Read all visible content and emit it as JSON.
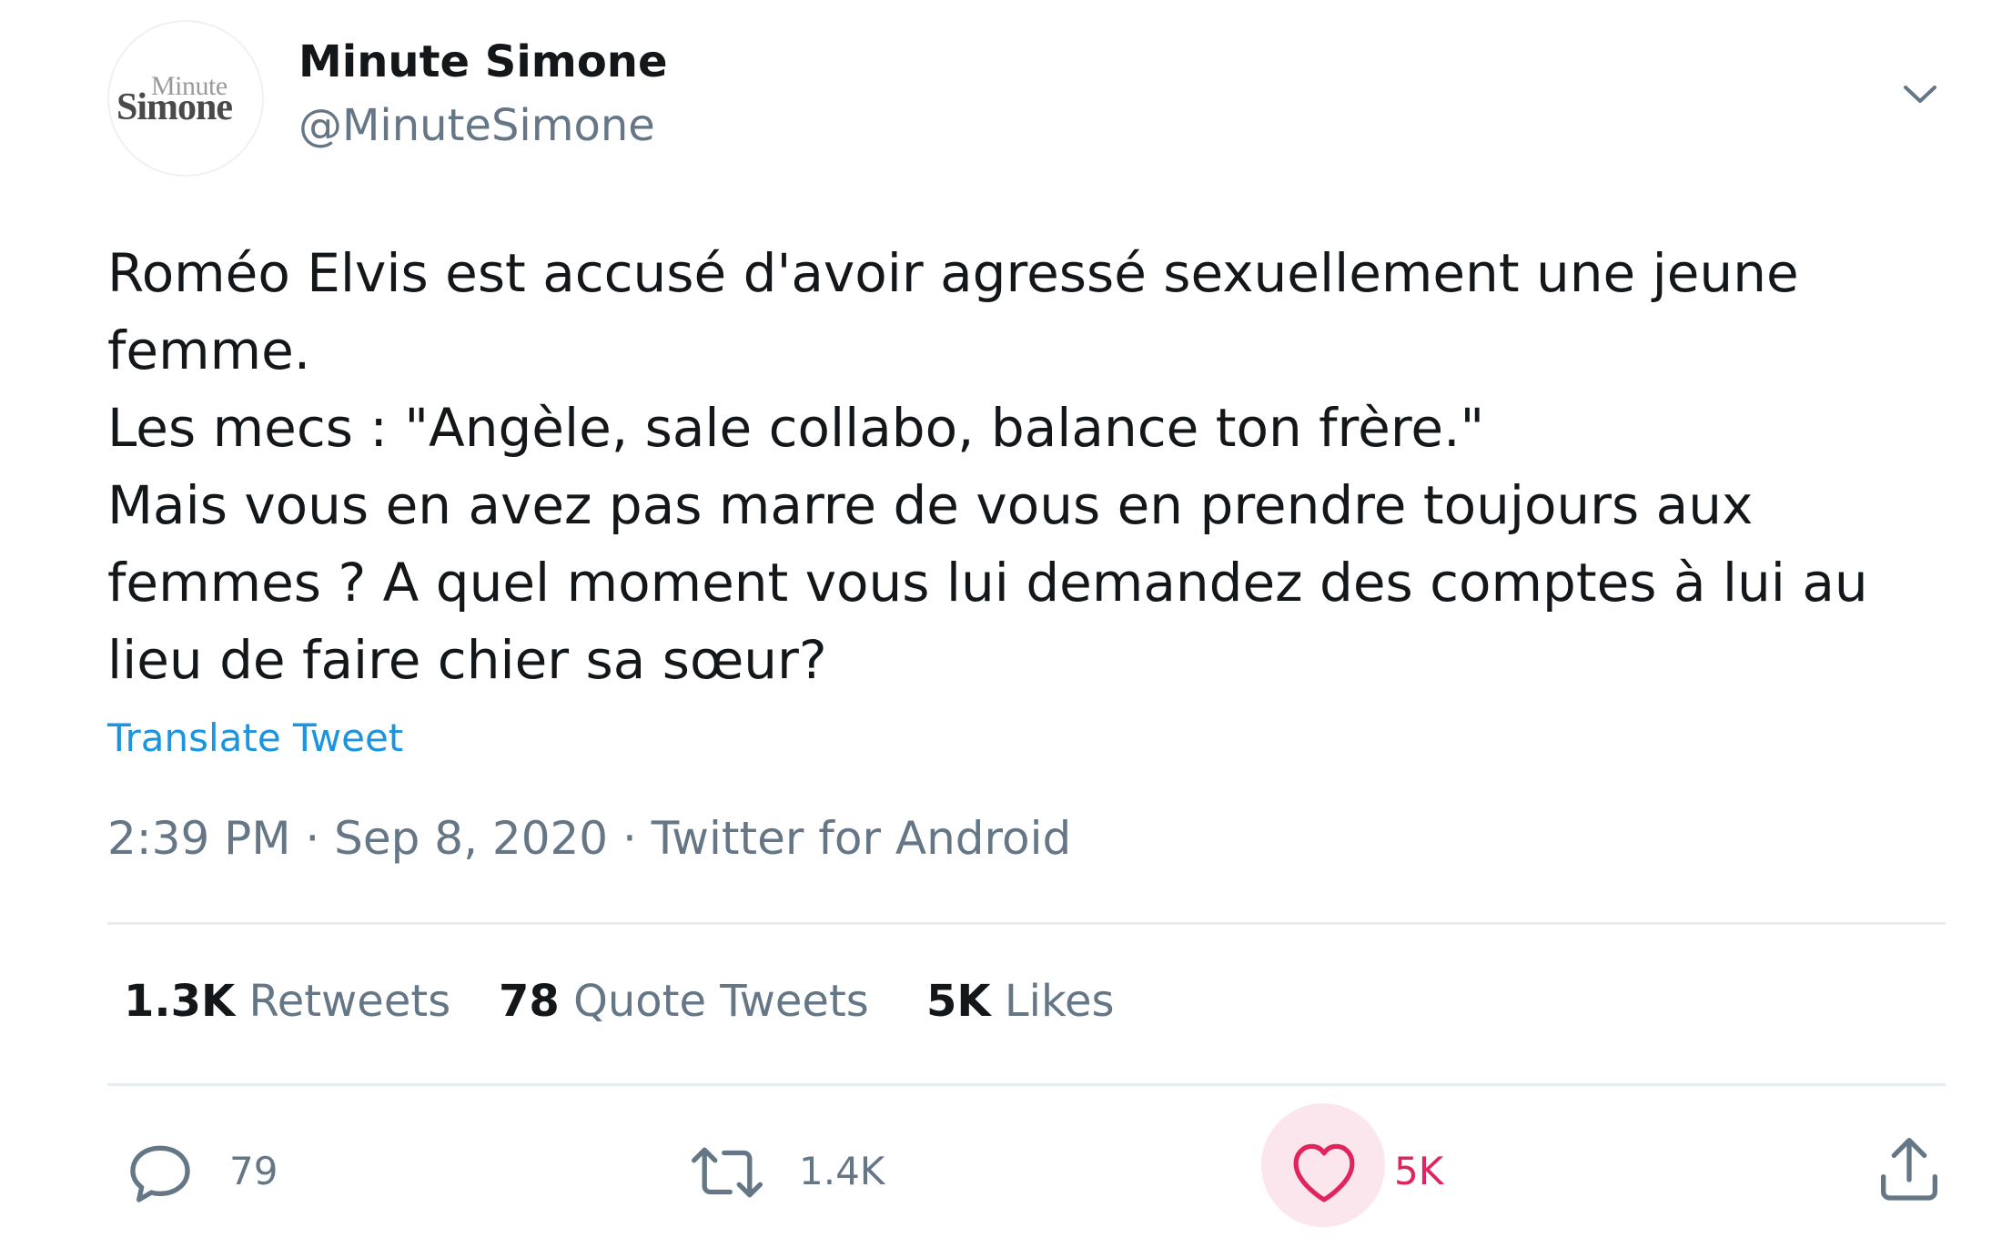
{
  "author": {
    "avatar_text_top": "Minute",
    "avatar_text_bottom": "Simone",
    "display_name": "Minute Simone",
    "handle": "@MinuteSimone"
  },
  "tweet": {
    "lines": [
      "Roméo Elvis est accusé d'avoir agressé sexuellement une jeune",
      "femme.",
      "Les mecs : \"Angèle, sale collabo, balance ton frère.\"",
      "Mais vous en avez pas marre de vous en prendre toujours aux",
      "femmes ? A quel moment vous lui demandez des comptes à lui au",
      "lieu de faire chier sa sœur?"
    ],
    "translate_label": "Translate Tweet",
    "meta": "2:39 PM · Sep 8, 2020 · Twitter for Android"
  },
  "stats": {
    "retweets_count": "1.3K",
    "retweets_label": "Retweets",
    "quotes_count": "78",
    "quotes_label": "Quote Tweets",
    "likes_count": "5K",
    "likes_label": "Likes"
  },
  "actions": {
    "reply_count": "79",
    "retweet_count": "1.4K",
    "like_count": "5K"
  },
  "colors": {
    "text": "#14171a",
    "secondary": "#657786",
    "link": "#1b95e0",
    "like": "#e0245e",
    "like_bg": "#fce6ee",
    "divider": "#e6ecf0"
  },
  "icons": {
    "caret": "chevron-down-icon",
    "reply": "reply-icon",
    "retweet": "retweet-icon",
    "like": "heart-icon",
    "share": "share-icon"
  }
}
